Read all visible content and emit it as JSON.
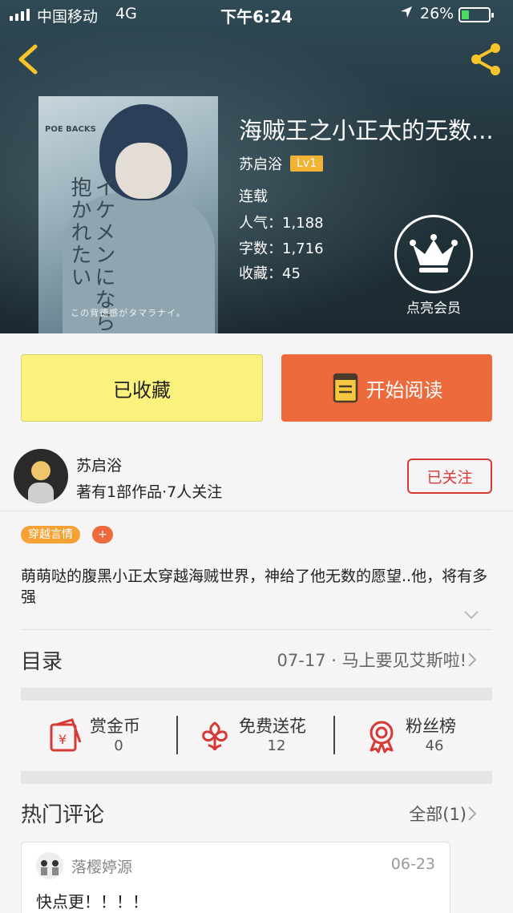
{
  "status_bar": {
    "carrier": "中国移动",
    "network": "4G",
    "time": "下午6:24",
    "battery": "26%"
  },
  "book": {
    "title": "海贼王之小正太的无数...",
    "author": "苏启浴",
    "level_badge": "Lv1",
    "status": "连载",
    "popularity": "人气：1,188",
    "word_count": "字数：1,716",
    "favorites": "收藏：45",
    "vip_label": "点亮会员"
  },
  "cover": {
    "vertical_title": "イケメンになら抱かれたい",
    "series": "POE BACKS",
    "tagline": "この背徳感がタマラナイ。"
  },
  "actions": {
    "collected_label": "已收藏",
    "read_label": "开始阅读"
  },
  "author_card": {
    "name": "苏启浴",
    "stats": "著有1部作品·7人关注",
    "follow_label": "已关注"
  },
  "tags": {
    "genre": "穿越言情",
    "add": "+"
  },
  "intro": "萌萌哒的腹黑小正太穿越海贼世界，神给了他无数的愿望..他，将有多强",
  "catalog": {
    "title": "目录",
    "latest": "07-17 · 马上要见艾斯啦!"
  },
  "stats": [
    {
      "label": "赏金币",
      "value": "0"
    },
    {
      "label": "免费送花",
      "value": "12"
    },
    {
      "label": "粉丝榜",
      "value": "46"
    }
  ],
  "comments": {
    "title": "热门评论",
    "all_label": "全部(1)",
    "items": [
      {
        "user": "落樱婷源",
        "date": "06-23",
        "text": "快点更！！！！"
      }
    ]
  },
  "colors": {
    "accent_orange": "#ec6a3c",
    "collected_yellow": "#fbf17d",
    "follow_red": "#d63a36",
    "tag_orange": "#f4a233",
    "level_gold": "#f2b233"
  },
  "icons": {
    "back": "chevron-left-icon",
    "share": "share-icon",
    "vip": "crown-icon",
    "read": "book-icon",
    "coin": "red-envelope-icon",
    "flower": "flower-icon",
    "fans": "medal-icon"
  }
}
